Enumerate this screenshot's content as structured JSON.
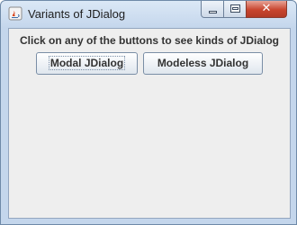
{
  "window": {
    "title": "Variants of JDialog",
    "controls": {
      "minimize": "minimize",
      "maximize": "maximize",
      "close": "✕"
    }
  },
  "content": {
    "heading": "Click on any of the buttons to see kinds of JDialog",
    "buttons": {
      "modal": "Modal JDialog",
      "modeless": "Modeless JDialog"
    }
  }
}
